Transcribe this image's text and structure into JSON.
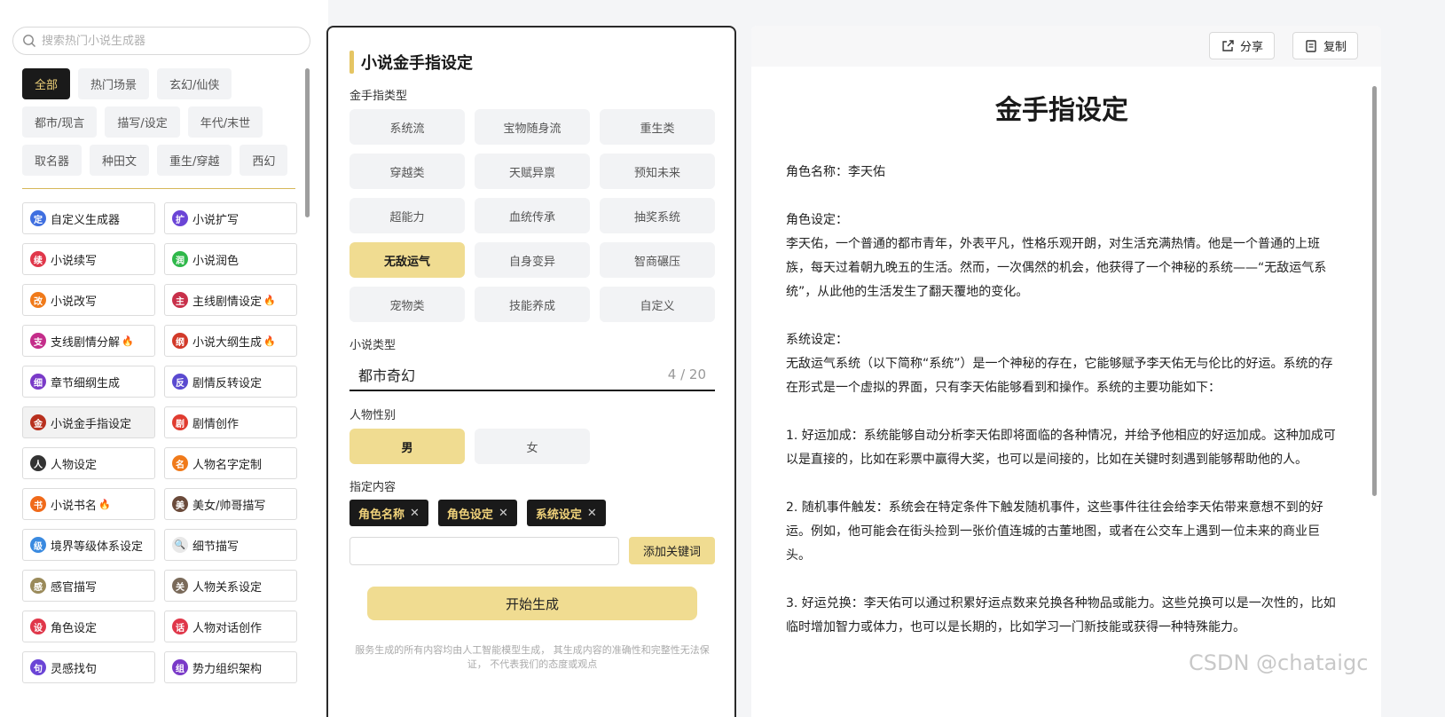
{
  "search": {
    "placeholder": "搜索热门小说生成器"
  },
  "categories": [
    {
      "label": "全部",
      "active": true
    },
    {
      "label": "热门场景"
    },
    {
      "label": "玄幻/仙侠"
    },
    {
      "label": "都市/现言"
    },
    {
      "label": "描写/设定"
    },
    {
      "label": "年代/末世"
    },
    {
      "label": "取名器"
    },
    {
      "label": "种田文"
    },
    {
      "label": "重生/穿越"
    },
    {
      "label": "西幻"
    }
  ],
  "tools": [
    {
      "label": "自定义生成器",
      "glyph": "定",
      "color": "#3f6fe0"
    },
    {
      "label": "小说扩写",
      "glyph": "扩",
      "color": "#6b45d6"
    },
    {
      "label": "小说续写",
      "glyph": "续",
      "color": "#e0374a"
    },
    {
      "label": "小说润色",
      "glyph": "润",
      "color": "#2fb84a"
    },
    {
      "label": "小说改写",
      "glyph": "改",
      "color": "#f07a1a"
    },
    {
      "label": "主线剧情设定",
      "glyph": "主",
      "color": "#c8304a",
      "hot": true
    },
    {
      "label": "支线剧情分解",
      "glyph": "支",
      "color": "#c42d8a",
      "hot": true
    },
    {
      "label": "小说大纲生成",
      "glyph": "纲",
      "color": "#d23a2a",
      "hot": true
    },
    {
      "label": "章节细纲生成",
      "glyph": "细",
      "color": "#7a3ac8"
    },
    {
      "label": "剧情反转设定",
      "glyph": "反",
      "color": "#5a4ad0"
    },
    {
      "label": "小说金手指设定",
      "glyph": "金",
      "color": "#b8301e",
      "selected": true
    },
    {
      "label": "剧情创作",
      "glyph": "剧",
      "color": "#e03c30"
    },
    {
      "label": "人物设定",
      "glyph": "人",
      "color": "#333333"
    },
    {
      "label": "人物名字定制",
      "glyph": "名",
      "color": "#f07a1a"
    },
    {
      "label": "小说书名",
      "glyph": "书",
      "color": "#f06a1a",
      "hot": true
    },
    {
      "label": "美女/帅哥描写",
      "glyph": "美",
      "color": "#6a4a3a"
    },
    {
      "label": "境界等级体系设定",
      "glyph": "级",
      "color": "#3a8ae0"
    },
    {
      "label": "细节描写",
      "glyph": "🔍",
      "color": "#e8e8e8"
    },
    {
      "label": "感官描写",
      "glyph": "感",
      "color": "#9a8a5a"
    },
    {
      "label": "人物关系设定",
      "glyph": "关",
      "color": "#7a6a5a"
    },
    {
      "label": "角色设定",
      "glyph": "设",
      "color": "#e0374a"
    },
    {
      "label": "人物对话创作",
      "glyph": "话",
      "color": "#e0374a"
    },
    {
      "label": "灵感找句",
      "glyph": "句",
      "color": "#6b45d6"
    },
    {
      "label": "势力组织架构",
      "glyph": "组",
      "color": "#7a3ac8"
    }
  ],
  "form": {
    "title": "小说金手指设定",
    "type_label": "金手指类型",
    "types": [
      {
        "label": "系统流"
      },
      {
        "label": "宝物随身流"
      },
      {
        "label": "重生类"
      },
      {
        "label": "穿越类"
      },
      {
        "label": "天赋异禀"
      },
      {
        "label": "预知未来"
      },
      {
        "label": "超能力"
      },
      {
        "label": "血统传承"
      },
      {
        "label": "抽奖系统"
      },
      {
        "label": "无敌运气",
        "active": true
      },
      {
        "label": "自身变异"
      },
      {
        "label": "智商碾压"
      },
      {
        "label": "宠物类"
      },
      {
        "label": "技能养成"
      },
      {
        "label": "自定义"
      }
    ],
    "novel_label": "小说类型",
    "novel_value": "都市奇幻",
    "novel_count": "4 / 20",
    "gender_label": "人物性别",
    "genders": [
      {
        "label": "男",
        "active": true
      },
      {
        "label": "女"
      }
    ],
    "content_label": "指定内容",
    "tags": [
      "角色名称",
      "角色设定",
      "系统设定"
    ],
    "keyword_button": "添加关键词",
    "generate_button": "开始生成",
    "disclaimer": "服务生成的所有内容均由人工智能模型生成， 其生成内容的准确性和完整性无法保证， 不代表我们的态度或观点"
  },
  "output": {
    "share_label": "分享",
    "copy_label": "复制",
    "title": "金手指设定",
    "paragraphs": [
      "角色名称：李天佑",
      "",
      "角色设定：",
      "李天佑，一个普通的都市青年，外表平凡，性格乐观开朗，对生活充满热情。他是一个普通的上班族，每天过着朝九晚五的生活。然而，一次偶然的机会，他获得了一个神秘的系统——“无敌运气系统”，从此他的生活发生了翻天覆地的变化。",
      "",
      "系统设定：",
      "无敌运气系统（以下简称“系统”）是一个神秘的存在，它能够赋予李天佑无与伦比的好运。系统的存在形式是一个虚拟的界面，只有李天佑能够看到和操作。系统的主要功能如下：",
      "",
      "1. 好运加成：系统能够自动分析李天佑即将面临的各种情况，并给予他相应的好运加成。这种加成可以是直接的，比如在彩票中赢得大奖，也可以是间接的，比如在关键时刻遇到能够帮助他的人。",
      "",
      "2. 随机事件触发：系统会在特定条件下触发随机事件，这些事件往往会给李天佑带来意想不到的好运。例如，他可能会在街头捡到一张价值连城的古董地图，或者在公交车上遇到一位未来的商业巨头。",
      "",
      "3. 好运兑换：李天佑可以通过积累好运点数来兑换各种物品或能力。这些兑换可以是一次性的，比如临时增加智力或体力，也可以是长期的，比如学习一门新技能或获得一种特殊能力。"
    ]
  },
  "watermark": "CSDN @chataigc",
  "colors": {
    "accent": "#f0dc91",
    "dark": "#1a1a1a",
    "tag_text": "#f0d27a"
  }
}
